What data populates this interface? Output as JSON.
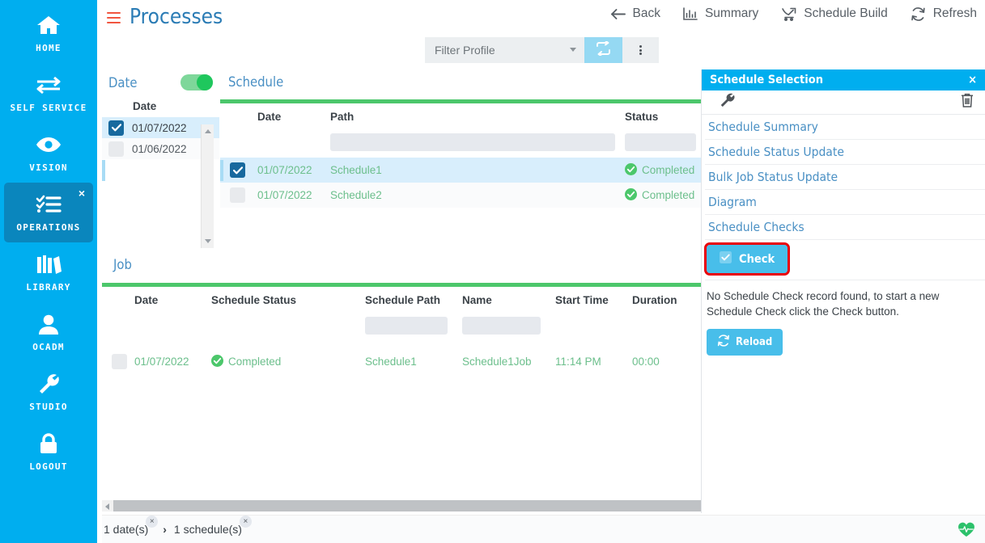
{
  "sidebar": {
    "items": [
      {
        "label": "HOME",
        "icon": "home-icon",
        "active": false
      },
      {
        "label": "SELF SERVICE",
        "icon": "exchange-arrows-icon",
        "active": false
      },
      {
        "label": "VISION",
        "icon": "eye-icon",
        "active": false
      },
      {
        "label": "OPERATIONS",
        "icon": "checklist-icon",
        "active": true,
        "close": "×"
      },
      {
        "label": "LIBRARY",
        "icon": "books-icon",
        "active": false
      },
      {
        "label": "OCADM",
        "icon": "user-icon",
        "active": false
      },
      {
        "label": "STUDIO",
        "icon": "wrench-icon",
        "active": false
      },
      {
        "label": "LOGOUT",
        "icon": "lock-icon",
        "active": false
      }
    ]
  },
  "header": {
    "menu_icon": "hamburger-icon",
    "title": "Processes",
    "actions": [
      {
        "label": "Back",
        "icon": "arrow-left-icon"
      },
      {
        "label": "Summary",
        "icon": "bar-chart-icon"
      },
      {
        "label": "Schedule Build",
        "icon": "schedule-build-icon"
      },
      {
        "label": "Refresh",
        "icon": "refresh-icon"
      }
    ]
  },
  "filterbar": {
    "profile_value": "Filter Profile",
    "refresh_icon": "sync-icon",
    "kebab_icon": "more-vertical-icon"
  },
  "date_panel": {
    "title": "Date",
    "toggle_on": true,
    "column_header": "Date",
    "rows": [
      {
        "date": "01/07/2022",
        "checked": true
      },
      {
        "date": "01/06/2022",
        "checked": false
      }
    ]
  },
  "schedule_panel": {
    "title": "Schedule",
    "columns": [
      "Date",
      "Path",
      "Status"
    ],
    "rows": [
      {
        "checked": true,
        "date": "01/07/2022",
        "path": "Schedule1",
        "status": "Completed"
      },
      {
        "checked": false,
        "date": "01/07/2022",
        "path": "Schedule2",
        "status": "Completed"
      }
    ]
  },
  "job_panel": {
    "title": "Job",
    "columns": [
      "Date",
      "Schedule Status",
      "Schedule Path",
      "Name",
      "Start Time",
      "Duration"
    ],
    "rows": [
      {
        "checked": false,
        "date": "01/07/2022",
        "schedule_status": "Completed",
        "schedule_path": "Schedule1",
        "name": "Schedule1Job",
        "start_time": "11:14 PM",
        "duration": "00:00"
      }
    ]
  },
  "right_panel": {
    "title": "Schedule Selection",
    "close_label": "×",
    "toolbar": {
      "wrench_icon": "wrench-icon",
      "trash_icon": "trash-icon"
    },
    "links": [
      "Schedule Summary",
      "Schedule Status Update",
      "Bulk Job Status Update",
      "Diagram",
      "Schedule Checks"
    ],
    "check_button": "Check",
    "message": "No Schedule Check record found, to start a new Schedule Check click the Check button.",
    "reload_button": "Reload"
  },
  "footer": {
    "crumbs": [
      "1 date(s)",
      "1 schedule(s)"
    ],
    "separator": "›",
    "close_mark": "×",
    "heartbeat_icon": "heartbeat-icon"
  },
  "colors": {
    "brand_blue": "#00AEEF",
    "nav_active": "#0a86bd",
    "accent_green": "#4CC76B",
    "status_green": "#4CC76B",
    "highlight_row": "#d8eefc",
    "button_blue": "#48BEEA",
    "focus_red": "#E8000A",
    "title_blue": "#4a90c4",
    "hamburger_red": "#F1553F"
  }
}
